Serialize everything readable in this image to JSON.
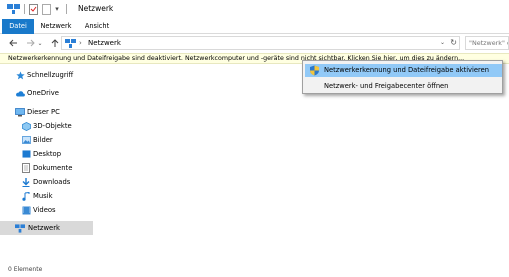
{
  "window": {
    "title": "Netzwerk"
  },
  "ribbon": {
    "tabs": [
      {
        "label": "Datei",
        "active": true
      },
      {
        "label": "Netzwerk",
        "active": false
      },
      {
        "label": "Ansicht",
        "active": false
      }
    ]
  },
  "navigation": {
    "address_segment": "Netzwerk",
    "address_chevron": "›",
    "search_placeholder": "\"Netzwerk\" d"
  },
  "infobar": {
    "text": "Netzwerkerkennung und Dateifreigabe sind deaktiviert. Netzwerkcomputer und -geräte sind nicht sichtbar. Klicken Sie hier, um dies zu ändern..."
  },
  "sidebar": {
    "items": [
      {
        "label": "Schnellzugriff",
        "icon": "star-icon"
      },
      {
        "label": "OneDrive",
        "icon": "cloud-icon"
      },
      {
        "label": "Dieser PC",
        "icon": "computer-icon"
      },
      {
        "label": "3D-Objekte",
        "icon": "cube-icon"
      },
      {
        "label": "Bilder",
        "icon": "pictures-icon"
      },
      {
        "label": "Desktop",
        "icon": "desktop-icon"
      },
      {
        "label": "Dokumente",
        "icon": "documents-icon"
      },
      {
        "label": "Downloads",
        "icon": "download-icon"
      },
      {
        "label": "Musik",
        "icon": "music-icon"
      },
      {
        "label": "Videos",
        "icon": "video-icon"
      },
      {
        "label": "Netzwerk",
        "icon": "network-icon",
        "selected": true
      }
    ]
  },
  "status": {
    "text": "0 Elemente"
  },
  "context_menu": {
    "items": [
      {
        "label": "Netzwerkerkennung und Dateifreigabe aktivieren",
        "icon": "shield-icon",
        "highlighted": true
      },
      {
        "label": "Netzwerk- und Freigabecenter öffnen",
        "highlighted": false
      }
    ]
  },
  "colors": {
    "accent": "#1979ca",
    "infobar": "#ffffe1",
    "menu_highlight": "#91c9f7",
    "selected": "#d9d9d9"
  }
}
